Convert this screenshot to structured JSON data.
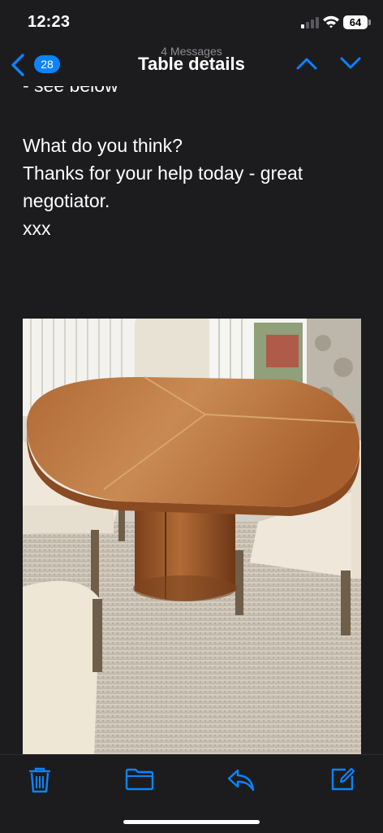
{
  "status_bar": {
    "time": "12:23",
    "battery": "64"
  },
  "nav": {
    "back_count": "28",
    "subtitle": "4 Messages",
    "title": "Table details"
  },
  "message": {
    "cut_line": "- see below",
    "lines": [
      "What do you think?",
      "Thanks for your help today - great",
      "negotiator.",
      "xxx"
    ]
  },
  "toolbar": {
    "icons": [
      "trash-icon",
      "folder-icon",
      "reply-icon",
      "compose-icon"
    ]
  },
  "colors": {
    "accent": "#0a84ff",
    "background": "#1c1c1e"
  }
}
